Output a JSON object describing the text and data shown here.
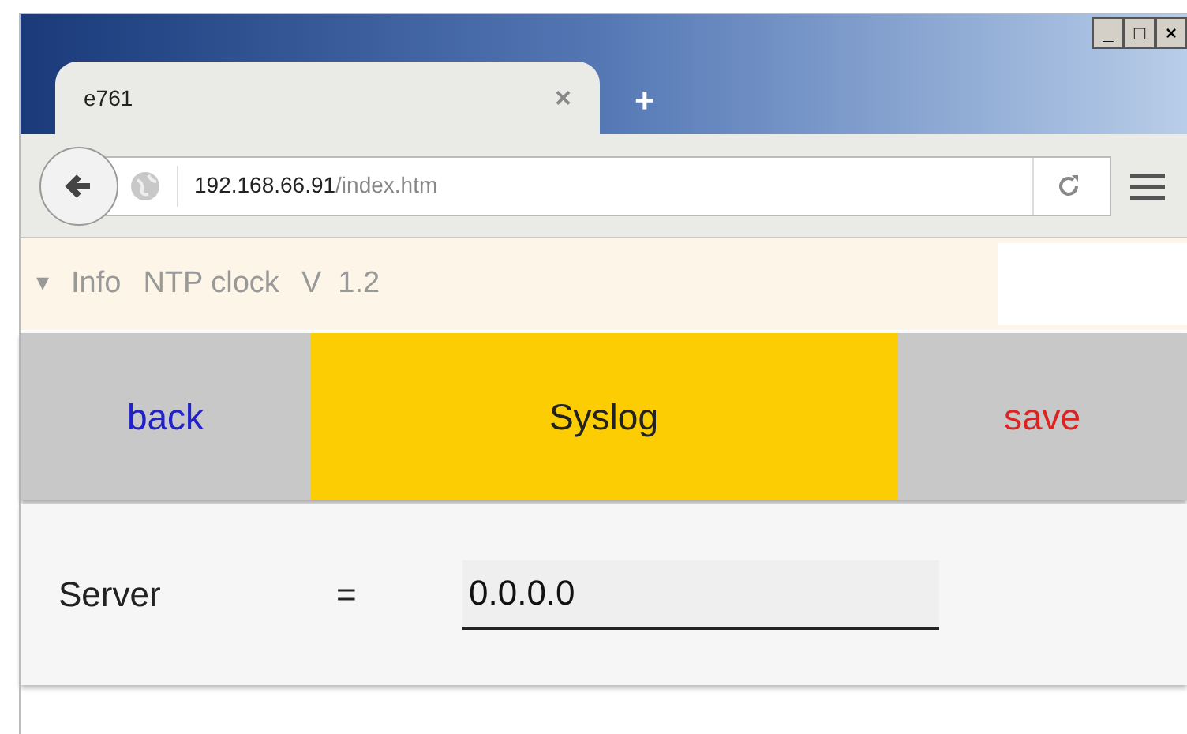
{
  "window": {
    "controls": [
      "_",
      "□",
      "×"
    ]
  },
  "tabs": [
    {
      "label": "e761",
      "selected": true,
      "close": "×"
    }
  ],
  "new_tab": "+",
  "address_bar": {
    "host": "192.168.66.91",
    "path": "/index.htm"
  },
  "info_bar": {
    "toggle": "▾",
    "items": [
      "Info",
      "NTP clock",
      "V  1.2"
    ]
  },
  "nav": [
    {
      "kind": "link",
      "label": "back",
      "color": "#2222cc"
    },
    {
      "kind": "title",
      "label": "Syslog",
      "color": "#222222"
    },
    {
      "kind": "link",
      "label": "save",
      "color": "#dd2222"
    }
  ],
  "form": [
    {
      "label": "Server",
      "separator": "=",
      "value": "0.0.0.0"
    }
  ]
}
